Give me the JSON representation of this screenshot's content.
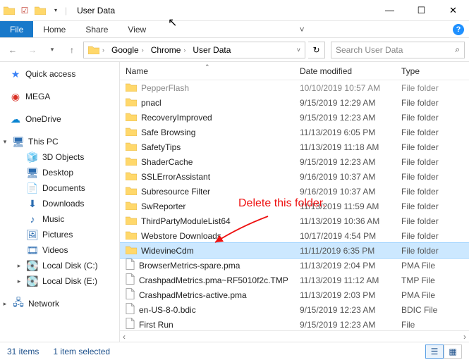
{
  "window": {
    "title": "User Data"
  },
  "ribbon": {
    "file": "File",
    "tabs": [
      "Home",
      "Share",
      "View"
    ]
  },
  "breadcrumb": {
    "segments": [
      "Google",
      "Chrome",
      "User Data"
    ]
  },
  "search": {
    "placeholder": "Search User Data"
  },
  "tree": {
    "quick": "Quick access",
    "mega": "MEGA",
    "onedrive": "OneDrive",
    "thispc": "This PC",
    "pc_items": [
      "3D Objects",
      "Desktop",
      "Documents",
      "Downloads",
      "Music",
      "Pictures",
      "Videos",
      "Local Disk (C:)",
      "Local Disk (E:)"
    ],
    "network": "Network"
  },
  "columns": {
    "name": "Name",
    "date": "Date modified",
    "type": "Type"
  },
  "files": [
    {
      "name": "PepperFlash",
      "date": "10/10/2019 10:57 AM",
      "type": "File folder",
      "icon": "folder",
      "faded": true
    },
    {
      "name": "pnacl",
      "date": "9/15/2019 12:29 AM",
      "type": "File folder",
      "icon": "folder"
    },
    {
      "name": "RecoveryImproved",
      "date": "9/15/2019 12:23 AM",
      "type": "File folder",
      "icon": "folder"
    },
    {
      "name": "Safe Browsing",
      "date": "11/13/2019 6:05 PM",
      "type": "File folder",
      "icon": "folder"
    },
    {
      "name": "SafetyTips",
      "date": "11/13/2019 11:18 AM",
      "type": "File folder",
      "icon": "folder"
    },
    {
      "name": "ShaderCache",
      "date": "9/15/2019 12:23 AM",
      "type": "File folder",
      "icon": "folder"
    },
    {
      "name": "SSLErrorAssistant",
      "date": "9/16/2019 10:37 AM",
      "type": "File folder",
      "icon": "folder"
    },
    {
      "name": "Subresource Filter",
      "date": "9/16/2019 10:37 AM",
      "type": "File folder",
      "icon": "folder"
    },
    {
      "name": "SwReporter",
      "date": "11/13/2019 11:59 AM",
      "type": "File folder",
      "icon": "folder"
    },
    {
      "name": "ThirdPartyModuleList64",
      "date": "11/13/2019 10:36 AM",
      "type": "File folder",
      "icon": "folder"
    },
    {
      "name": "Webstore Downloads",
      "date": "10/17/2019 4:54 PM",
      "type": "File folder",
      "icon": "folder"
    },
    {
      "name": "WidevineCdm",
      "date": "11/11/2019 6:35 PM",
      "type": "File folder",
      "icon": "folder",
      "selected": true
    },
    {
      "name": "BrowserMetrics-spare.pma",
      "date": "11/13/2019 2:04 PM",
      "type": "PMA File",
      "icon": "file"
    },
    {
      "name": "CrashpadMetrics.pma~RF5010f2c.TMP",
      "date": "11/13/2019 11:12 AM",
      "type": "TMP File",
      "icon": "file"
    },
    {
      "name": "CrashpadMetrics-active.pma",
      "date": "11/13/2019 2:03 PM",
      "type": "PMA File",
      "icon": "file"
    },
    {
      "name": "en-US-8-0.bdic",
      "date": "9/15/2019 12:23 AM",
      "type": "BDIC File",
      "icon": "file"
    },
    {
      "name": "First Run",
      "date": "9/15/2019 12:23 AM",
      "type": "File",
      "icon": "file"
    }
  ],
  "annotation": "Delete this folder.",
  "status": {
    "count": "31 items",
    "sel": "1 item selected"
  }
}
